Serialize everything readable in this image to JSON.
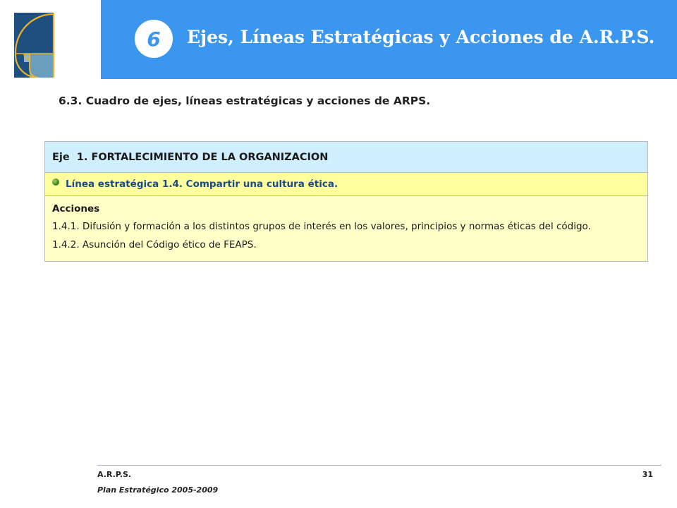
{
  "header": {
    "number": "6",
    "title": "Ejes, Líneas Estratégicas y Acciones de A.R.P.S.",
    "band_color": "#3b96f0",
    "logo_icon": "golden-spiral-logo-icon"
  },
  "section": {
    "title": "6.3. Cuadro de ejes, líneas estratégicas y acciones de ARPS."
  },
  "table": {
    "eje": "Eje  1. FORTALECIMIENTO DE LA ORGANIZACION",
    "linea": "Línea estratégica 1.4. Compartir una cultura ética.",
    "linea_icon": "green-bullet-icon",
    "acciones_label": "Acciones",
    "acciones": [
      "1.4.1. Difusión y formación a los distintos grupos de interés en los valores, principios y normas éticas del código.",
      "1.4.2. Asunción del Código ético de FEAPS."
    ],
    "colors": {
      "eje_bg": "#cfeefe",
      "linea_bg": "#ffff9e",
      "acciones_bg": "#ffffc8"
    }
  },
  "footer": {
    "org": "A.R.P.S.",
    "page": "31",
    "plan": "Plan Estratégico 2005-2009"
  }
}
